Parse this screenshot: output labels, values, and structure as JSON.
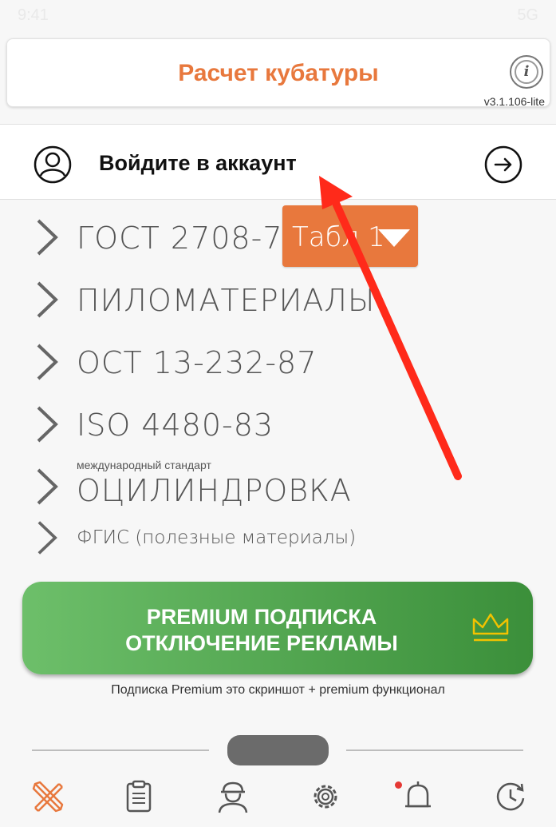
{
  "status_bar": {
    "time": "9:41",
    "right": "5G"
  },
  "header": {
    "title": "Расчет кубатуры",
    "version": "v3.1.106-lite",
    "info_icon": "i"
  },
  "login": {
    "label": "Войдите в аккаунт"
  },
  "menu": {
    "items": [
      {
        "label": "ГОСТ 2708-75"
      },
      {
        "label": "ПИЛОМАТЕРИАЛЫ"
      },
      {
        "label": "ОСТ 13-232-87"
      },
      {
        "label": "ISO 4480-83"
      },
      {
        "label": "ОЦИЛИНДРОВКА",
        "sublabel": "международный стандарт"
      },
      {
        "label": "ФГИС (полезные материалы)"
      }
    ],
    "table_dropdown": {
      "label": "Табл 1"
    }
  },
  "premium": {
    "line1": "PREMIUM ПОДПИСКА",
    "line2": "ОТКЛЮЧЕНИЕ РЕКЛАМЫ",
    "note": "Подписка Premium это скриншот + premium функционал"
  },
  "tabbar": {
    "tabs": [
      {
        "icon": "ruler-pencil-icon",
        "active": true
      },
      {
        "icon": "clipboard-icon"
      },
      {
        "icon": "worker-icon"
      },
      {
        "icon": "gear-icon"
      },
      {
        "icon": "bell-icon",
        "badge": true
      },
      {
        "icon": "history-icon"
      }
    ]
  },
  "colors": {
    "accent": "#e8783d",
    "premium_start": "#6dbf6a",
    "premium_end": "#3b8f3a",
    "annotation": "#ff2a1a"
  }
}
